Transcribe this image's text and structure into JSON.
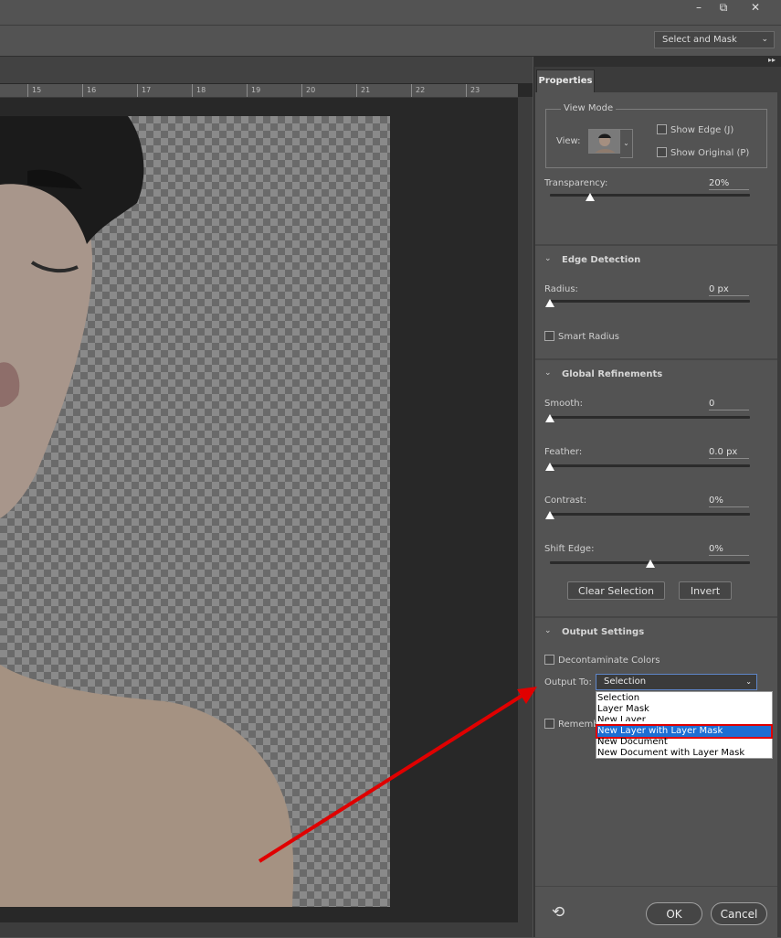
{
  "titlebar": {
    "minimize": "–",
    "restore": "⧉",
    "close": "✕"
  },
  "workspace": {
    "label": "Select and Mask"
  },
  "ruler": {
    "ticks": [
      "15",
      "16",
      "17",
      "18",
      "19",
      "20",
      "21",
      "22",
      "23"
    ]
  },
  "panel": {
    "expand_icon": "▸▸",
    "tab": "Properties",
    "view_mode": {
      "title": "View Mode",
      "view_label": "View:",
      "show_edge": "Show Edge (J)",
      "show_original": "Show Original (P)",
      "transparency_label": "Transparency:",
      "transparency_value": "20%",
      "transparency_fraction": 0.2
    },
    "edge_detection": {
      "title": "Edge Detection",
      "radius_label": "Radius:",
      "radius_value": "0 px",
      "smart_radius": "Smart Radius"
    },
    "global_refinements": {
      "title": "Global Refinements",
      "smooth_label": "Smooth:",
      "smooth_value": "0",
      "feather_label": "Feather:",
      "feather_value": "0.0 px",
      "contrast_label": "Contrast:",
      "contrast_value": "0%",
      "shift_edge_label": "Shift Edge:",
      "shift_edge_value": "0%",
      "clear_selection": "Clear Selection",
      "invert": "Invert"
    },
    "output_settings": {
      "title": "Output Settings",
      "decontaminate": "Decontaminate Colors",
      "output_to_label": "Output To:",
      "output_to_value": "Selection",
      "remember_partial": "Rememb",
      "options": [
        "Selection",
        "Layer Mask",
        "New Layer",
        "New Layer with Layer Mask",
        "New Document",
        "New Document with Layer Mask"
      ],
      "highlighted_option": "New Layer with Layer Mask"
    },
    "footer": {
      "reset_icon": "⟲",
      "ok": "OK",
      "cancel": "Cancel"
    }
  },
  "colors": {
    "annotation_red": "#e00000",
    "selection_blue": "#1c6ed4"
  }
}
